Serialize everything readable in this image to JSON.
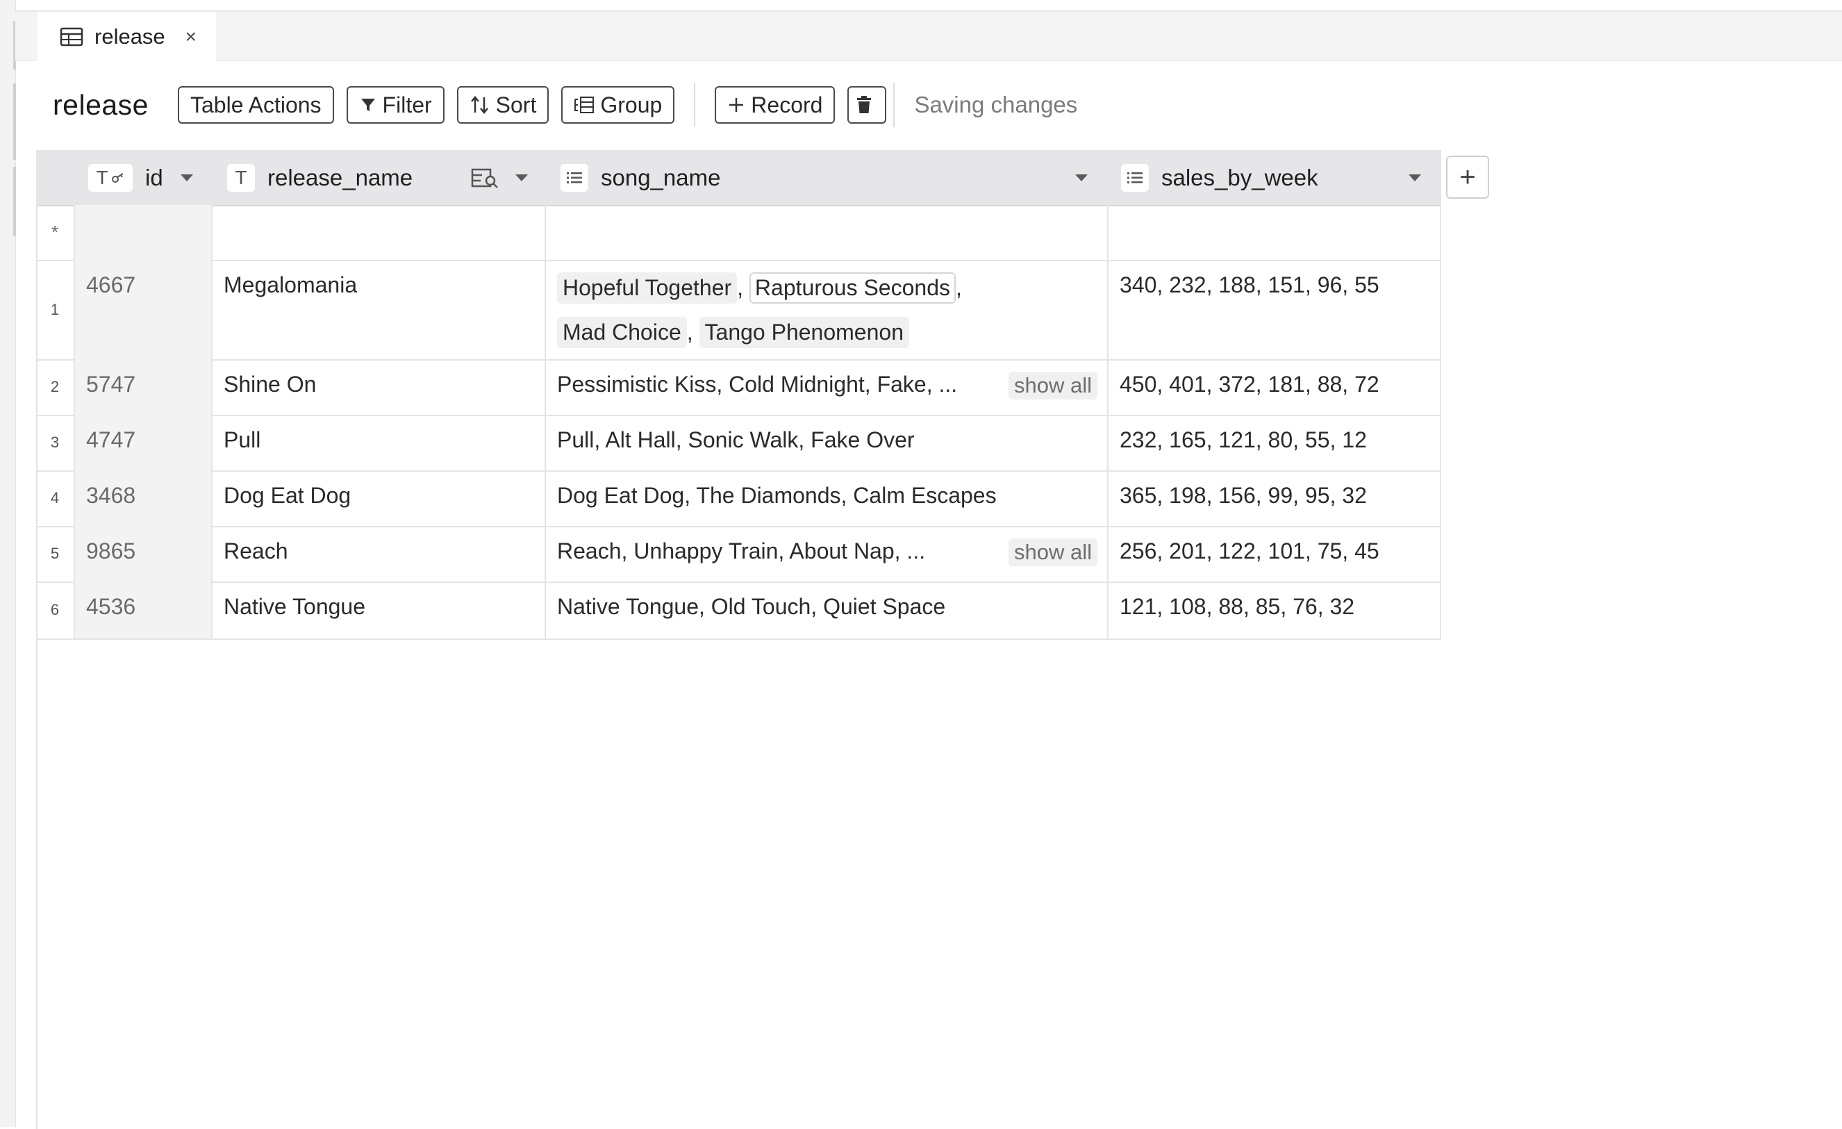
{
  "tab": {
    "label": "release",
    "close": "×"
  },
  "toolbar": {
    "title": "release",
    "table_actions": "Table Actions",
    "filter": "Filter",
    "sort": "Sort",
    "group": "Group",
    "record": "Record",
    "status": "Saving changes"
  },
  "columns": [
    {
      "name": "id",
      "type_icon": "T"
    },
    {
      "name": "release_name",
      "type_icon": "T"
    },
    {
      "name": "song_name",
      "type_icon": "list-icon"
    },
    {
      "name": "sales_by_week",
      "type_icon": "list-icon"
    }
  ],
  "new_row_marker": "*",
  "show_all_label": "show all",
  "rows": [
    {
      "num": "1",
      "id": "4667",
      "release_name": "Megalomania",
      "song_tags": [
        "Hopeful Together",
        "Rapturous Seconds",
        "Mad Choice",
        "Tango Phenomenon"
      ],
      "sales": "340, 232, 188, 151, 96, 55"
    },
    {
      "num": "2",
      "id": "5747",
      "release_name": "Shine On",
      "songs": "Pessimistic Kiss, Cold Midnight, Fake, ...",
      "truncated": true,
      "sales": "450, 401, 372, 181, 88, 72"
    },
    {
      "num": "3",
      "id": "4747",
      "release_name": "Pull",
      "songs": "Pull, Alt Hall, Sonic Walk, Fake Over",
      "sales": "232, 165, 121, 80, 55, 12"
    },
    {
      "num": "4",
      "id": "3468",
      "release_name": "Dog Eat Dog",
      "songs": "Dog Eat Dog, The Diamonds, Calm Escapes",
      "sales": "365, 198, 156, 99, 95, 32"
    },
    {
      "num": "5",
      "id": "9865",
      "release_name": "Reach",
      "songs": "Reach, Unhappy Train, About Nap, ...",
      "truncated": true,
      "sales": "256, 201, 122, 101, 75, 45"
    },
    {
      "num": "6",
      "id": "4536",
      "release_name": "Native Tongue",
      "songs": "Native Tongue, Old Touch, Quiet Space",
      "sales": "121, 108, 88, 85, 76, 32"
    }
  ]
}
